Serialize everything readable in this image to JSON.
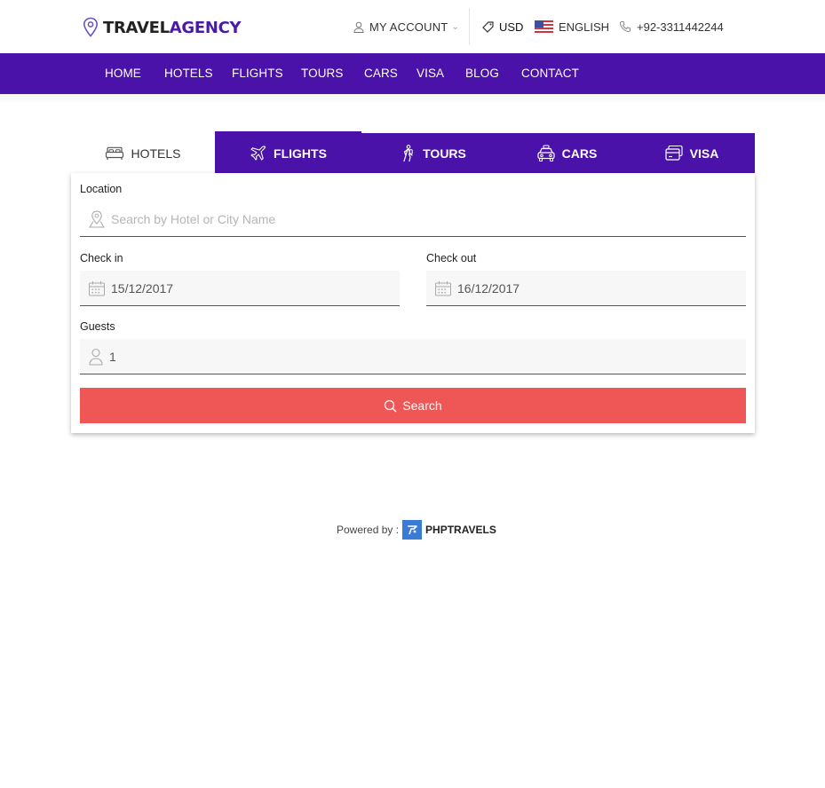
{
  "brand": {
    "part1": "TRAVEL",
    "part2": "AGENCY"
  },
  "topbar": {
    "account": "MY ACCOUNT",
    "currency": "USD",
    "language": "ENGLISH",
    "phone": "+92-3311442244"
  },
  "nav": [
    "HOME",
    "HOTELS",
    "FLIGHTS",
    "TOURS",
    "CARS",
    "VISA",
    "BLOG",
    "CONTACT"
  ],
  "tabs": [
    {
      "label": "HOTELS",
      "icon": "bed-icon",
      "active": true
    },
    {
      "label": "FLIGHTS",
      "icon": "plane-icon",
      "active": false
    },
    {
      "label": "TOURS",
      "icon": "hiker-icon",
      "active": false
    },
    {
      "label": "CARS",
      "icon": "car-icon",
      "active": false
    },
    {
      "label": "VISA",
      "icon": "card-icon",
      "active": false
    }
  ],
  "form": {
    "location_label": "Location",
    "location_placeholder": "Search by Hotel or City Name",
    "checkin_label": "Check in",
    "checkin_value": "15/12/2017",
    "checkout_label": "Check out",
    "checkout_value": "16/12/2017",
    "guests_label": "Guests",
    "guests_value": "1",
    "search_label": "Search"
  },
  "footer": {
    "powered_by": "Powered by :",
    "brand": "PHPTRAVELS"
  },
  "colors": {
    "primary": "#4a12a9",
    "accent": "#ef5656",
    "logo_accent": "#4b1aa9"
  }
}
